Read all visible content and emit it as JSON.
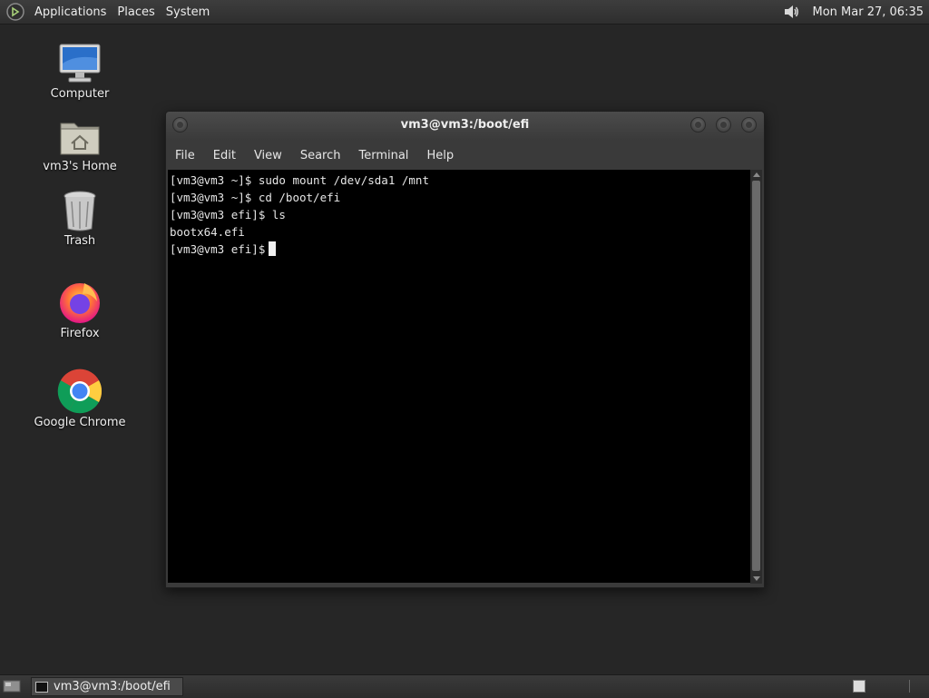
{
  "top_panel": {
    "menus": [
      "Applications",
      "Places",
      "System"
    ],
    "clock": "Mon Mar 27, 06:35",
    "volume_icon": "speaker-icon"
  },
  "desktop": {
    "icons": [
      {
        "label": "Computer",
        "icon": "computer-icon"
      },
      {
        "label": "vm3's Home",
        "icon": "home-folder-icon"
      },
      {
        "label": "Trash",
        "icon": "trash-icon"
      },
      {
        "label": "Firefox",
        "icon": "firefox-icon"
      },
      {
        "label": "Google Chrome",
        "icon": "chrome-icon"
      }
    ]
  },
  "terminal": {
    "title": "vm3@vm3:/boot/efi",
    "menu": [
      "File",
      "Edit",
      "View",
      "Search",
      "Terminal",
      "Help"
    ],
    "lines": [
      "[vm3@vm3 ~]$ sudo mount /dev/sda1 /mnt",
      "[vm3@vm3 ~]$ cd /boot/efi",
      "[vm3@vm3 efi]$ ls",
      "bootx64.efi",
      "[vm3@vm3 efi]$"
    ]
  },
  "taskbar": {
    "window_button": "vm3@vm3:/boot/efi"
  },
  "colors": {
    "desktop_bg": "#262626",
    "terminal_bg": "#000000",
    "panel_bg": "#333333"
  }
}
